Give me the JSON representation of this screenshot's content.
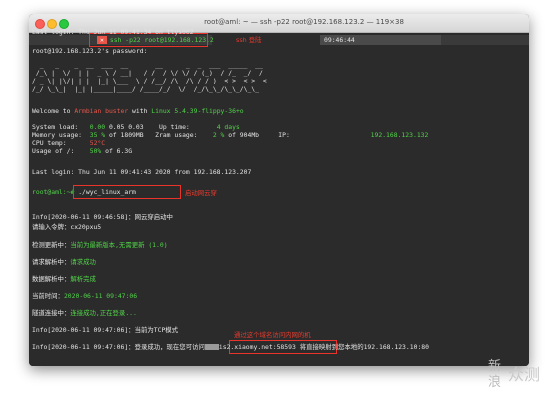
{
  "window": {
    "title": "root@aml: ~ — ssh -p22 root@192.168.123.2 — 119×38"
  },
  "terminal": {
    "last_login_1": "Last login: Thu Jun 11 09:41:34 on ttys002",
    "prompt_ssh_cmd": "ssh -p22 root@192.168.123.2",
    "ssh_note": "ssh 登陆",
    "prompt_time": "09:46:44",
    "password_prompt": "root@192.168.123.2's password:",
    "ascii_art": [
      "  _   _    _  __  ___  __       __      _  _  ___  _____  __  ",
      " /_\\ |  \\/  | |  _ \\ / __|   / /  / \\/ \\/ / (_)  / /_  _/  / ",
      "/ _ \\| |\\/| | |  |_| \\___  \\ / /__/ /\\  /\\ / / )  < >  < >  <  ",
      "/_/ \\_\\_|  |_| |_____|____/ /____/_/  \\/  /_/\\_\\_/\\_\\_/\\_\\_ "
    ],
    "welcome_prefix": "Welcome to ",
    "welcome_os": "Armbian buster",
    "welcome_mid": " with ",
    "welcome_kernel": "Linux 5.4.39-flippy-36+o",
    "sysload_label": "System load:   ",
    "sysload_value": "0.00",
    "sysload_rest": " 0.05 0.03",
    "uptime_label": "Up time:       ",
    "uptime_value": "4 days",
    "mem_label": "Memory usage:  ",
    "mem_value": "35 %",
    "mem_rest": " of 1809MB",
    "zram_label": "Zram usage:    ",
    "zram_value": "2 %",
    "zram_rest": " of 904Mb",
    "ip_label": "IP:",
    "ip_value": "192.168.123.132",
    "cpu_label": "CPU temp:      ",
    "cpu_value": "52°C",
    "usage_label": "Usage of /:    ",
    "usage_value": "50%",
    "usage_rest": " of 6.3G",
    "last_login_2": "Last login: Thu Jun 11 09:41:43 2020 from 192.168.123.207",
    "shell_prompt": "root@aml:~#",
    "shell_cmd": "./wyc_linux_arm",
    "run_note": "启动网云穿",
    "log_1_prefix": "Info[2020-06-11 09:46:58]：",
    "log_1_text": "网云穿启动中",
    "log_2_prefix": "请输入令牌：",
    "log_2_text": "cx20pxu5",
    "log_3_prefix": "检测更新中：",
    "log_3_text": "当前为最新版本,无需更新 (1.0)",
    "log_4_prefix": "请求解析中：",
    "log_4_text": "请求成功",
    "log_5_prefix": "数据解析中：",
    "log_5_text": "解析完成",
    "log_6_prefix": "当前时间：",
    "log_6_text": "2020-06-11 09:47:06",
    "log_7_prefix": "隧道连接中：",
    "log_7_text": "连接成功,正在登录...",
    "log_8_prefix": "Info[2020-06-11 09:47:06]：",
    "log_8_text": "当前为TCP模式",
    "ext_note": "通过这个域名访问内网的机",
    "log_9_prefix": "Info[2020-06-11 09:47:06]：登录成功，现在您可访问",
    "log_9_domain": "is2.xiaomy.net:58593",
    "log_9_suffix": " 将直接映射到您本地的192.168.123.10:80"
  },
  "watermark": {
    "line1": "新",
    "line2": "浪",
    "brand": "众测"
  }
}
